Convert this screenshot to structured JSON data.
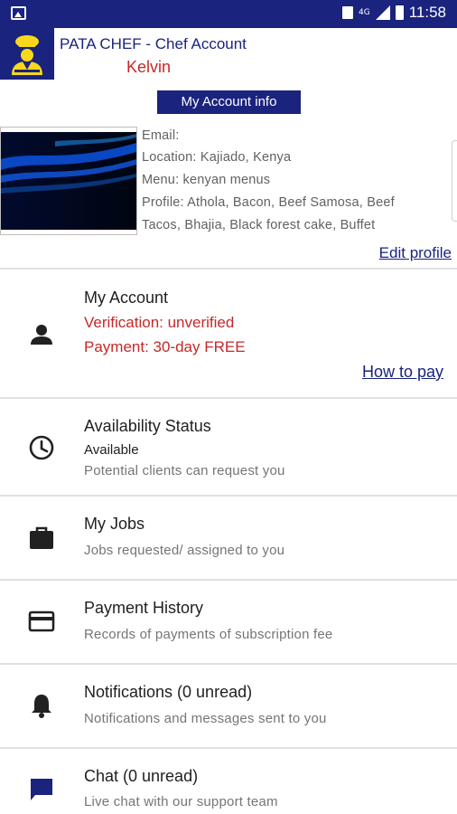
{
  "status_bar": {
    "time": "11:58",
    "icons": [
      "gallery-icon",
      "sim-icon",
      "4g-icon",
      "signal-icon",
      "battery-icon"
    ]
  },
  "header": {
    "title": "PATA CHEF - Chef Account",
    "user": "Kelvin"
  },
  "account_info_button": "My Account info",
  "profile": {
    "email": "Email:",
    "location": "Location: Kajiado, Kenya",
    "menu": "Menu: kenyan menus",
    "profile_line1": "Profile: Athola, Bacon, Beef Samosa, Beef",
    "profile_line2": "Tacos, Bhajia, Black forest cake, Buffet",
    "edit_link": "Edit profile"
  },
  "menu": {
    "my_account": {
      "title": "My Account",
      "verification": "Verification: unverified",
      "payment": "Payment: 30-day FREE",
      "how_to_pay": "How to pay"
    },
    "availability": {
      "title": "Availability Status",
      "status": "Available",
      "subtitle": "Potential clients can request you"
    },
    "jobs": {
      "title": "My Jobs",
      "subtitle": "Jobs requested/ assigned to you"
    },
    "payment_history": {
      "title": "Payment History",
      "subtitle": "Records of payments of subscription fee"
    },
    "notifications": {
      "title": "Notifications (0 unread)",
      "subtitle": "Notifications and messages sent to you"
    },
    "chat": {
      "title": "Chat (0 unread)",
      "subtitle": "Live chat with our support team"
    }
  },
  "colors": {
    "primary": "#1a237e",
    "alert": "#c62828",
    "muted": "#757575",
    "divider": "#e0e0e0"
  }
}
